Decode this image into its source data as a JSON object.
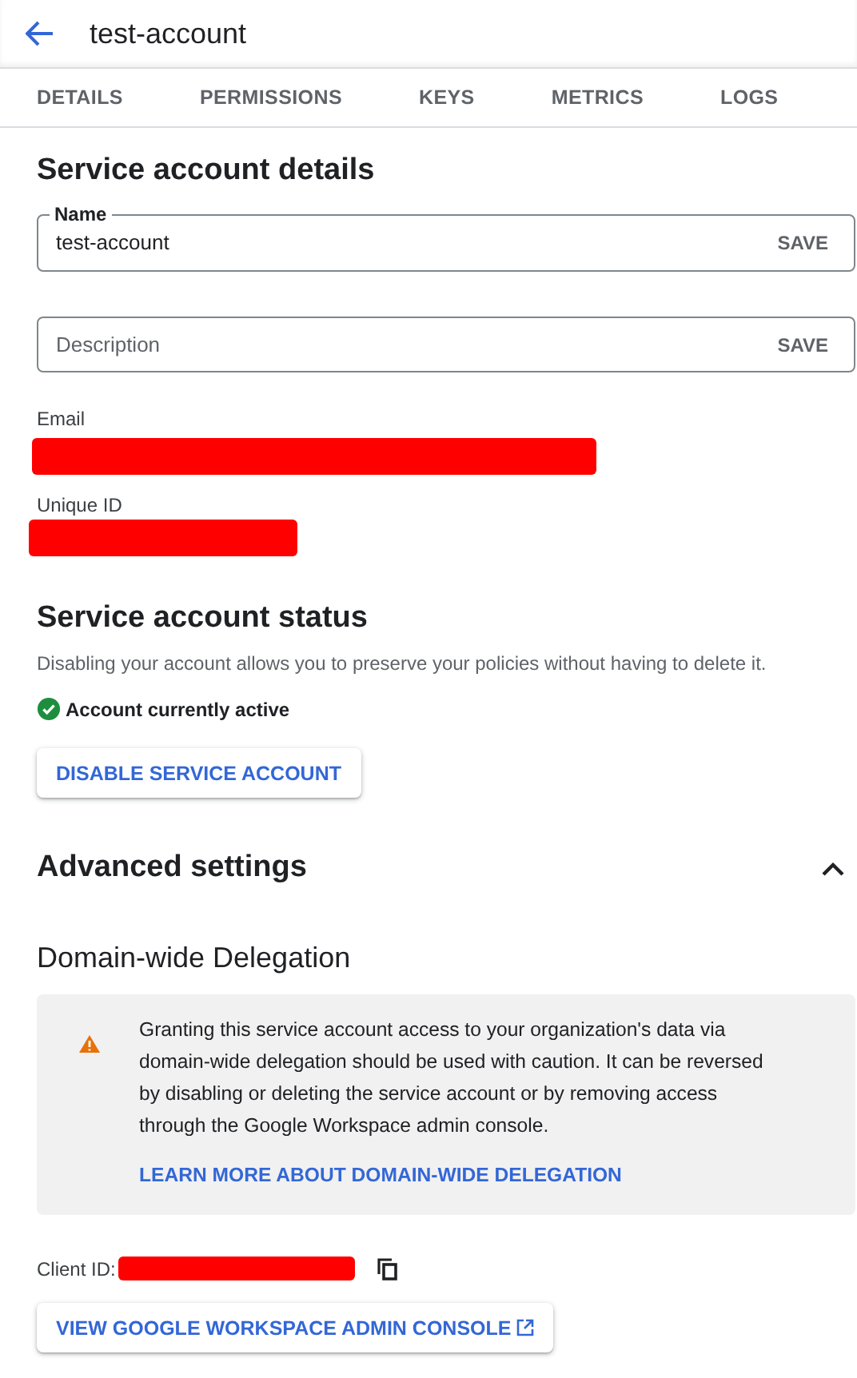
{
  "header": {
    "title": "test-account"
  },
  "tabs": [
    "DETAILS",
    "PERMISSIONS",
    "KEYS",
    "METRICS",
    "LOGS"
  ],
  "details": {
    "title": "Service account details",
    "name_field": {
      "label": "Name",
      "value": "test-account",
      "action": "SAVE"
    },
    "description_field": {
      "placeholder": "Description",
      "action": "SAVE"
    },
    "email_label": "Email",
    "unique_id_label": "Unique ID"
  },
  "status": {
    "title": "Service account status",
    "description": "Disabling your account allows you to preserve your policies without having to delete it.",
    "active": true,
    "state_text": "Account currently active",
    "button": "DISABLE SERVICE ACCOUNT"
  },
  "advanced": {
    "title": "Advanced settings",
    "expanded": true,
    "delegation_title": "Domain-wide Delegation",
    "warning": {
      "text": "Granting this service account access to your organization's data via domain-wide delegation should be used with caution. It can be reversed by disabling or deleting the service account or by removing access through the Google Workspace admin console.",
      "link": "LEARN MORE ABOUT DOMAIN-WIDE DELEGATION"
    },
    "client_id_label": "Client ID:",
    "console_button": "VIEW GOOGLE WORKSPACE ADMIN CONSOLE"
  }
}
